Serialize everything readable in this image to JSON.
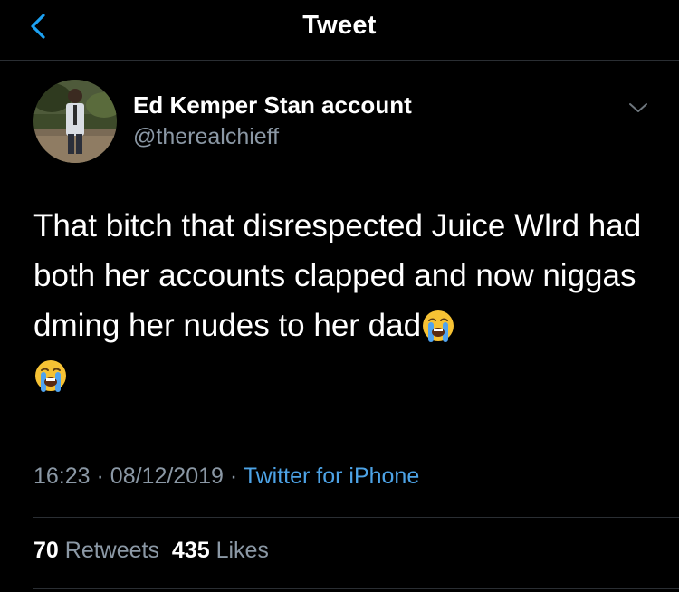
{
  "header": {
    "title": "Tweet",
    "back_icon": "chevron-left-icon",
    "accent_color": "#1da1f2"
  },
  "author": {
    "display_name": "Ed Kemper Stan account",
    "handle": "@therealchieff",
    "menu_icon": "chevron-down-icon"
  },
  "tweet": {
    "text": "That bitch that disrespected Juice Wlrd had both her accounts clapped and now niggas dming her nudes to her dad",
    "emoji": "loudly-crying-face-icon",
    "emoji_count": 2
  },
  "meta": {
    "time": "16:23",
    "separator": "·",
    "date": "08/12/2019",
    "source": "Twitter for iPhone"
  },
  "stats": {
    "retweets_count": "70",
    "retweets_label": "Retweets",
    "likes_count": "435",
    "likes_label": "Likes"
  },
  "colors": {
    "background": "#000000",
    "secondary_text": "#8b98a5",
    "link": "#4da3e6",
    "divider": "#2a2e33"
  }
}
